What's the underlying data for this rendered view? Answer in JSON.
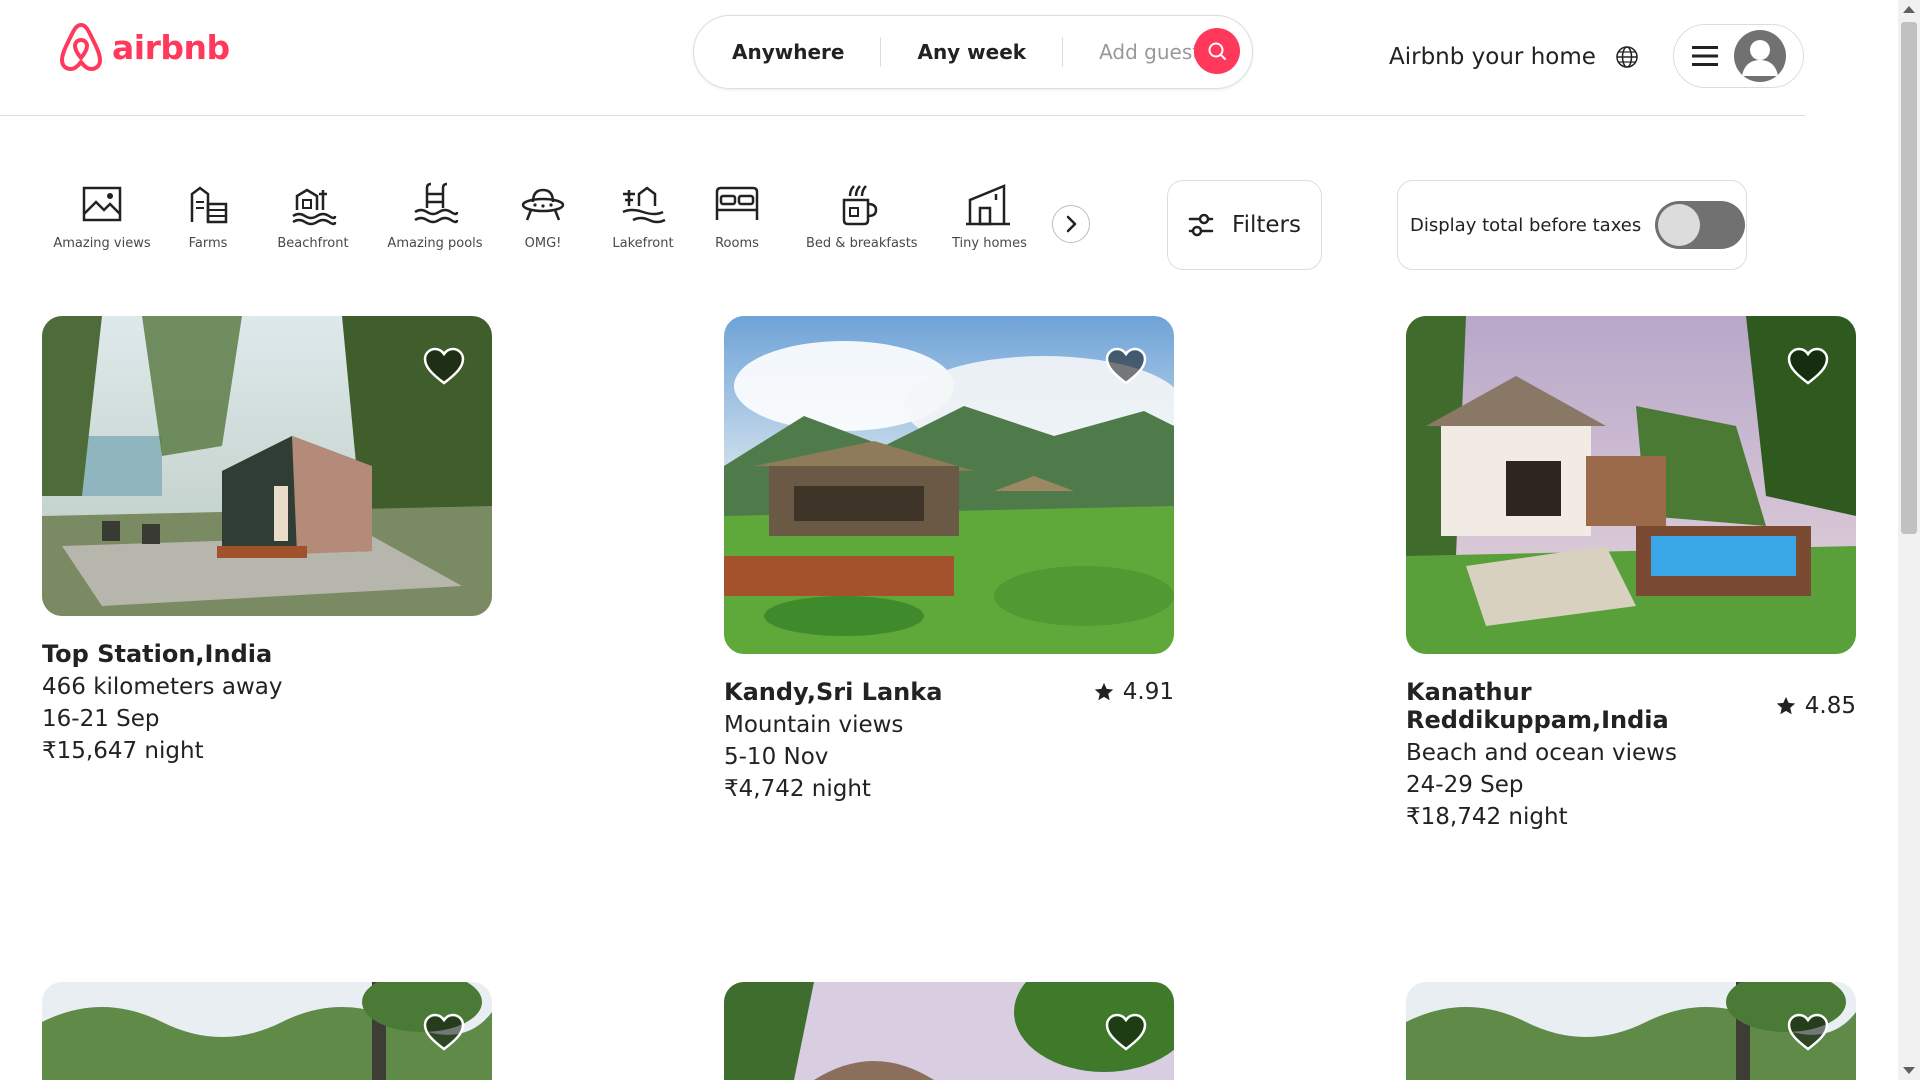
{
  "brand": {
    "name": "airbnb",
    "accent": "#ff385c"
  },
  "search": {
    "where": "Anywhere",
    "when": "Any week",
    "guests": "Add guests"
  },
  "header": {
    "host_link": "Airbnb your home"
  },
  "categories": [
    {
      "label": "Amazing views",
      "icon": "mountain-view-icon"
    },
    {
      "label": "Farms",
      "icon": "farm-icon"
    },
    {
      "label": "Beachfront",
      "icon": "beachfront-icon"
    },
    {
      "label": "Amazing pools",
      "icon": "pool-icon"
    },
    {
      "label": "OMG!",
      "icon": "ufo-icon"
    },
    {
      "label": "Lakefront",
      "icon": "lakefront-icon"
    },
    {
      "label": "Rooms",
      "icon": "bed-icon"
    },
    {
      "label": "Bed & breakfasts",
      "icon": "coffee-cup-icon"
    },
    {
      "label": "Tiny homes",
      "icon": "tiny-home-icon"
    }
  ],
  "filters": {
    "label": "Filters"
  },
  "taxes": {
    "label": "Display total before taxes",
    "enabled": false
  },
  "listings": [
    {
      "title": "Top Station,India",
      "rating": "",
      "subtitle": "466 kilometers away",
      "dates": "16-21 Sep",
      "price": "₹15,647 night"
    },
    {
      "title": "Kandy,Sri Lanka",
      "rating": "4.91",
      "subtitle": "Mountain views",
      "dates": "5-10 Nov",
      "price": "₹4,742 night"
    },
    {
      "title": "Kanathur Reddikuppam,India",
      "rating": "4.85",
      "subtitle": "Beach and ocean views",
      "dates": "24-29 Sep",
      "price": "₹18,742 night"
    }
  ]
}
